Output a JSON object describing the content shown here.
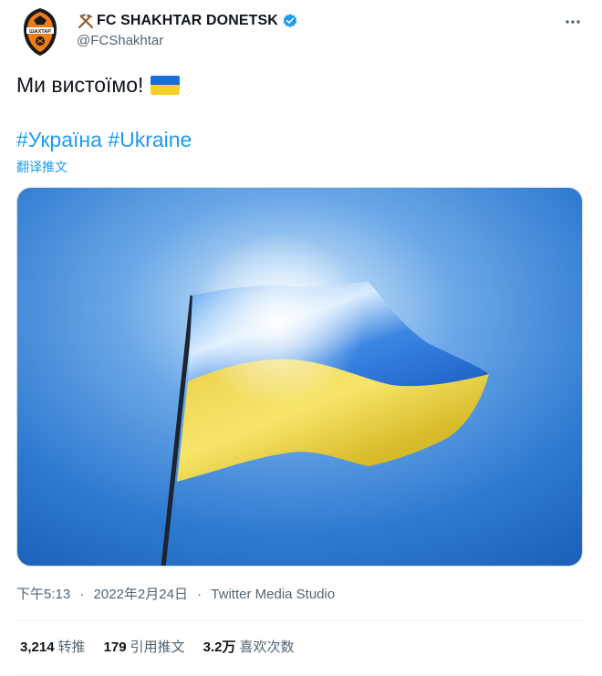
{
  "author": {
    "display_name": "FC SHAKHTAR DONETSK",
    "handle": "@FCShakhtar",
    "avatar_icon": "shakhtar-crest-icon",
    "name_emoji": "hammer-pick-icon",
    "verified_icon": "verified-badge-icon"
  },
  "tweet": {
    "text": "Ми вистоїмо!",
    "text_emoji": "ukraine-flag-icon",
    "hashtags": [
      "#Україна",
      "#Ukraine"
    ],
    "translate_label": "翻译推文",
    "media_alt": "ukraine-flag-photo"
  },
  "meta": {
    "time": "下午5:13",
    "date": "2022年2月24日",
    "separator": "·",
    "source": "Twitter Media Studio"
  },
  "stats": [
    {
      "value": "3,214",
      "label": "转推"
    },
    {
      "value": "179",
      "label": "引用推文"
    },
    {
      "value": "3.2万",
      "label": "喜欢次数"
    }
  ],
  "colors": {
    "link": "#1d9bf0",
    "secondary_text": "#536471",
    "primary_text": "#0f1419",
    "flag_blue": "#1a6fd6",
    "flag_yellow": "#f5d02a",
    "sky": "#2f7ad1"
  }
}
